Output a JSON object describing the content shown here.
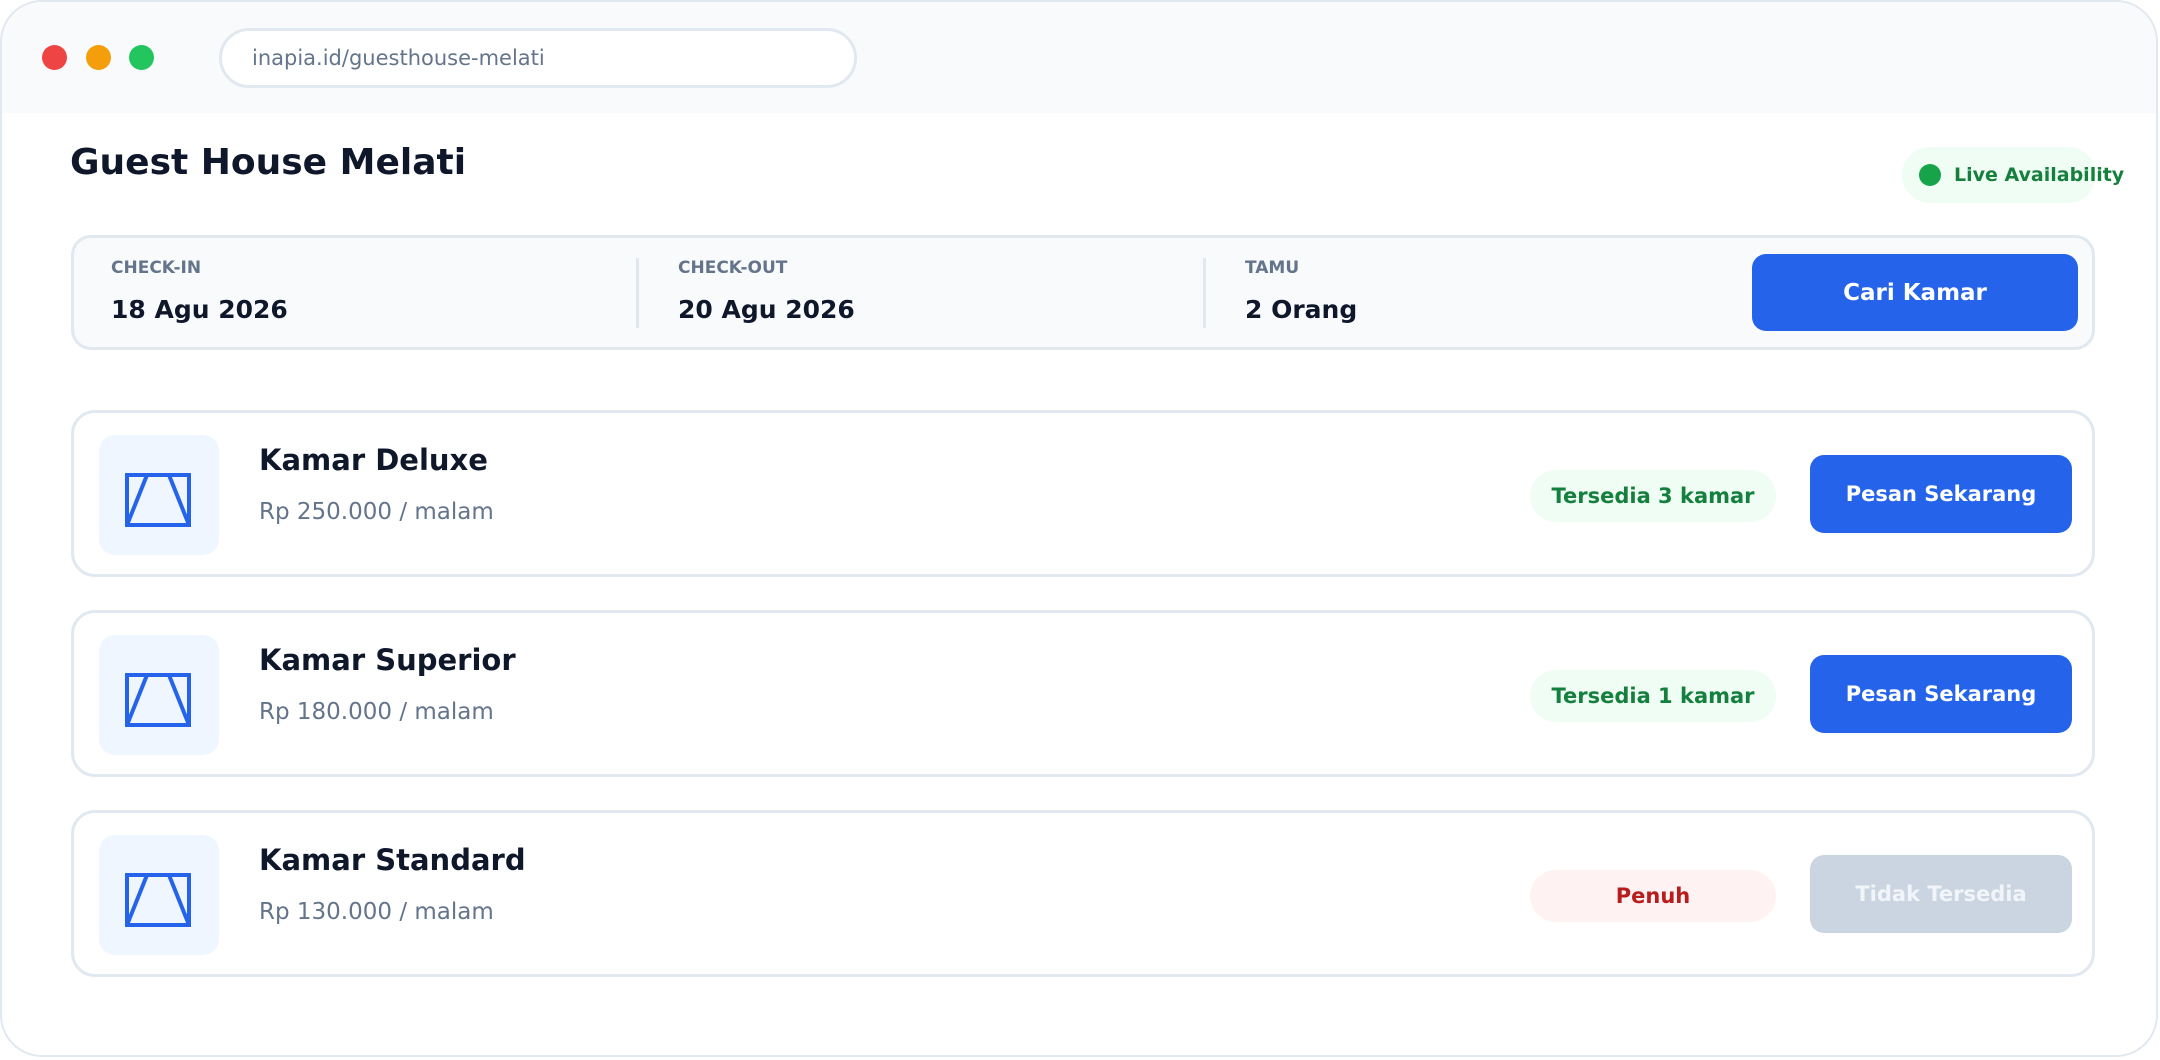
{
  "browser": {
    "url": "inapia.id/guesthouse-melati"
  },
  "header": {
    "title": "Guest House Melati",
    "live_label": "Live Availability"
  },
  "search": {
    "checkin_label": "CHECK-IN",
    "checkin_value": "18 Agu 2026",
    "checkout_label": "CHECK-OUT",
    "checkout_value": "20 Agu 2026",
    "guests_label": "TAMU",
    "guests_value": "2 Orang",
    "button_label": "Cari Kamar"
  },
  "rooms": [
    {
      "name": "Kamar Deluxe",
      "price": "Rp 250.000 / malam",
      "status": "Tersedia 3 kamar",
      "status_type": "available",
      "action": "Pesan Sekarang",
      "icon": "room-image-icon"
    },
    {
      "name": "Kamar Superior",
      "price": "Rp 180.000 / malam",
      "status": "Tersedia 1 kamar",
      "status_type": "available",
      "action": "Pesan Sekarang",
      "icon": "room-image-icon"
    },
    {
      "name": "Kamar Standard",
      "price": "Rp 130.000 / malam",
      "status": "Penuh",
      "status_type": "full",
      "action": "Tidak Tersedia",
      "icon": "room-image-icon"
    }
  ],
  "colors": {
    "primary": "#2563eb",
    "success": "#15803d",
    "success_bg": "#f0fdf4",
    "danger": "#b91c1c",
    "danger_bg": "#fef2f2",
    "disabled": "#cbd5e1"
  }
}
